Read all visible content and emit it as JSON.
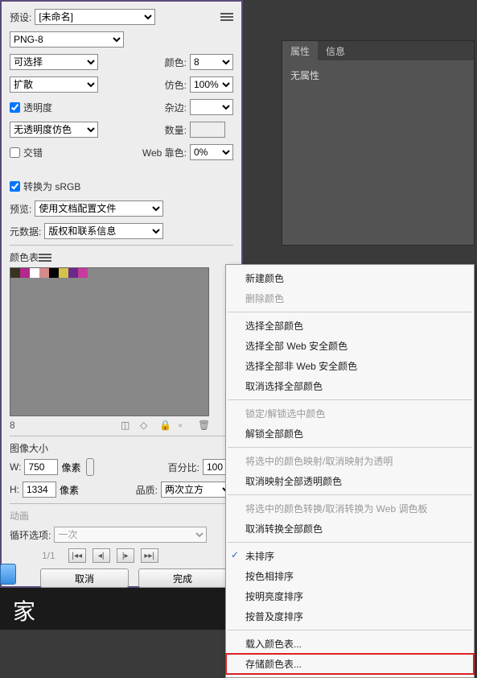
{
  "preset": {
    "label": "预设:",
    "value": "[未命名]"
  },
  "format": {
    "value": "PNG-8"
  },
  "rows": {
    "reduceAlgo": {
      "value": "可选择",
      "colorsLabel": "颜色:",
      "colorsValue": "8"
    },
    "dither": {
      "value": "扩散",
      "ditherLabel": "仿色:",
      "ditherValue": "100%"
    },
    "transparency": {
      "label": "透明度",
      "matteLabel": "杂边:"
    },
    "transDither": {
      "value": "无透明度仿色",
      "amountLabel": "数量:"
    },
    "interlace": {
      "label": "交错",
      "snapLabel": "Web 靠色:",
      "snapValue": "0%"
    },
    "srgb": {
      "label": "转换为 sRGB"
    },
    "preview": {
      "label": "预览:",
      "value": "使用文档配置文件"
    },
    "metadata": {
      "label": "元数据:",
      "value": "版权和联系信息"
    }
  },
  "colorTable": {
    "label": "颜色表",
    "count": "8",
    "swatches": [
      "#3a3322",
      "#b22a8a",
      "#fff",
      "#d68a8a",
      "#000",
      "#d4c24a",
      "#6a2a8a",
      "#c83aa0"
    ]
  },
  "imageSize": {
    "label": "图像大小",
    "wLabel": "W:",
    "wValue": "750",
    "px1": "像素",
    "hLabel": "H:",
    "hValue": "1334",
    "px2": "像素",
    "percentLabel": "百分比:",
    "percentValue": "100",
    "qualityLabel": "品质:",
    "qualityValue": "两次立方"
  },
  "anim": {
    "label": "动画",
    "loopLabel": "循环选项:",
    "loopValue": "一次",
    "frame": "1/1"
  },
  "buttons": {
    "cancel": "取消",
    "done": "完成"
  },
  "props": {
    "tab1": "属性",
    "tab2": "信息",
    "body": "无属性"
  },
  "menu": {
    "new": "新建颜色",
    "delete": "删除颜色",
    "selAll": "选择全部颜色",
    "selWeb": "选择全部 Web 安全颜色",
    "selNonWeb": "选择全部非 Web 安全颜色",
    "deselect": "取消选择全部颜色",
    "lock": "锁定/解锁选中颜色",
    "unlockAll": "解锁全部颜色",
    "mapTrans": "将选中的颜色映射/取消映射为透明",
    "unmapAll": "取消映射全部透明颜色",
    "shiftWeb": "将选中的颜色转换/取消转换为 Web 调色板",
    "unshiftAll": "取消转换全部颜色",
    "unsorted": "未排序",
    "sortHue": "按色相排序",
    "sortLum": "按明亮度排序",
    "sortPop": "按普及度排序",
    "load": "载入颜色表...",
    "save": "存储颜色表..."
  },
  "darkStrip": "家"
}
